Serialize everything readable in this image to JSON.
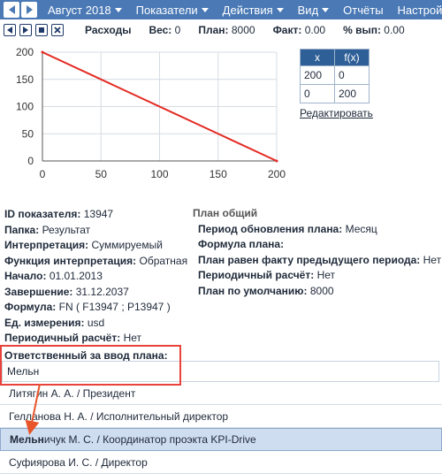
{
  "menubar": {
    "period": "Август 2018",
    "items": [
      "Показатели",
      "Действия",
      "Вид",
      "Отчёты",
      "Настройки"
    ]
  },
  "toolbar": {
    "name": "Расходы",
    "weight_label": "Вес:",
    "weight": "0",
    "plan_label": "План:",
    "plan": "8000",
    "fact_label": "Факт:",
    "fact": "0.00",
    "pct_label": "% вып:",
    "pct": "0.00"
  },
  "chart_data": {
    "type": "line",
    "x": [
      0,
      200
    ],
    "y": [
      200,
      0
    ],
    "xticks": [
      "0",
      "50",
      "100",
      "150",
      "200"
    ],
    "yticks": [
      "0",
      "50",
      "100",
      "150",
      "200"
    ],
    "xlim": [
      0,
      200
    ],
    "ylim": [
      0,
      200
    ],
    "grid": true,
    "colors": {
      "line": "#e32a22",
      "grid": "#d6dbe3",
      "axis": "#555555"
    }
  },
  "ftable": {
    "headers": [
      "x",
      "f(x)"
    ],
    "rows": [
      [
        "200",
        "0"
      ],
      [
        "0",
        "200"
      ]
    ],
    "edit_label": "Редактировать"
  },
  "info": [
    {
      "label": "ID показателя:",
      "value": "13947"
    },
    {
      "label": "Папка:",
      "value": "Результат"
    },
    {
      "label": "Интерпретация:",
      "value": "Суммируемый"
    },
    {
      "label": "Функция интерпретация:",
      "value": "Обратная"
    },
    {
      "label": "Начало:",
      "value": "01.01.2013"
    },
    {
      "label": "Завершение:",
      "value": "31.12.2037"
    },
    {
      "label": "Формула:",
      "value": "FN ( F13947 ; P13947 )"
    },
    {
      "label": "Ед. измерения:",
      "value": "usd"
    },
    {
      "label": "Периодичный расчёт:",
      "value": "Нет"
    }
  ],
  "plan": {
    "heading": "План общий",
    "rows": [
      {
        "label": "Период обновления плана:",
        "value": "Месяц"
      },
      {
        "label": "Формула плана:",
        "value": ""
      },
      {
        "label": "План равен факту предыдущего периода:",
        "value": "Нет"
      },
      {
        "label": "Периодичный расчёт:",
        "value": "Нет"
      },
      {
        "label": "План по умолчанию:",
        "value": "8000"
      }
    ]
  },
  "responsible": {
    "label": "Ответственный за ввод плана:",
    "value": "Мельн",
    "options": [
      {
        "match": "",
        "rest": "Литягин А. А. / Президент"
      },
      {
        "match": "",
        "rest": "Гелланова Н. А. / Исполнительный директор"
      },
      {
        "match": "Мельн",
        "rest": "ичук М. С. / Координатор проэкта KPI-Drive"
      },
      {
        "match": "",
        "rest": "Суфиярова И. С. / Директор"
      }
    ]
  }
}
